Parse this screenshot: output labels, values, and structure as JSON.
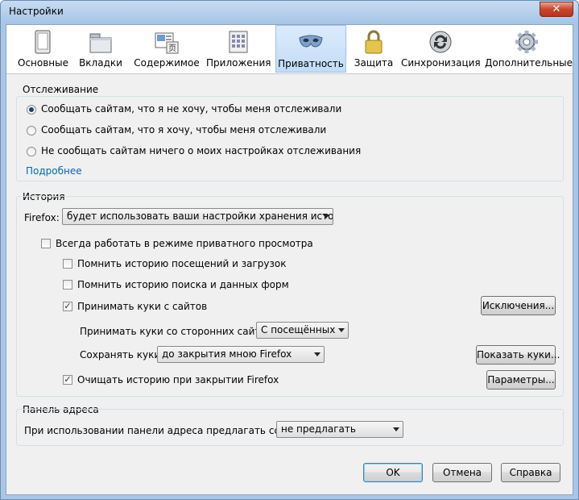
{
  "window": {
    "title": "Настройки",
    "close_label": "✕"
  },
  "toolbar": {
    "items": [
      {
        "label": "Основные",
        "icon": "general-icon"
      },
      {
        "label": "Вкладки",
        "icon": "tabs-icon"
      },
      {
        "label": "Содержимое",
        "icon": "content-icon"
      },
      {
        "label": "Приложения",
        "icon": "applications-icon"
      },
      {
        "label": "Приватность",
        "icon": "privacy-mask-icon",
        "selected": true
      },
      {
        "label": "Защита",
        "icon": "padlock-icon"
      },
      {
        "label": "Синхронизация",
        "icon": "sync-icon"
      },
      {
        "label": "Дополнительные",
        "icon": "gear-icon"
      }
    ]
  },
  "tracking": {
    "title": "Отслеживание",
    "options": [
      "Сообщать сайтам, что я не хочу, чтобы меня отслеживали",
      "Сообщать сайтам, что я хочу, чтобы меня отслеживали",
      "Не сообщать сайтам ничего о моих настройках отслеживания"
    ],
    "selected_index": 0,
    "more_link": "Подробнее"
  },
  "history": {
    "title": "История",
    "firefox_label": "Firefox:",
    "mode_value": "будет использовать ваши настройки хранения истории",
    "private_mode": "Всегда работать в режиме приватного просмотра",
    "remember_visits": "Помнить историю посещений и загрузок",
    "remember_search": "Помнить историю поиска и данных форм",
    "accept_cookies": "Принимать куки с сайтов",
    "exceptions_button": "Исключения...",
    "third_party_label": "Принимать куки со сторонних сайтов:",
    "third_party_value": "С посещённых",
    "keep_label": "Сохранять куки:",
    "keep_value": "до закрытия мною Firefox",
    "show_cookies_button": "Показать куки...",
    "clear_on_close": "Очищать историю при закрытии Firefox",
    "settings_button": "Параметры..."
  },
  "address_bar": {
    "title": "Панель адреса",
    "suggest_label": "При использовании панели адреса предлагать ссылки:",
    "suggest_value": "не предлагать"
  },
  "footer": {
    "ok": "OK",
    "cancel": "Отмена",
    "help": "Справка"
  }
}
